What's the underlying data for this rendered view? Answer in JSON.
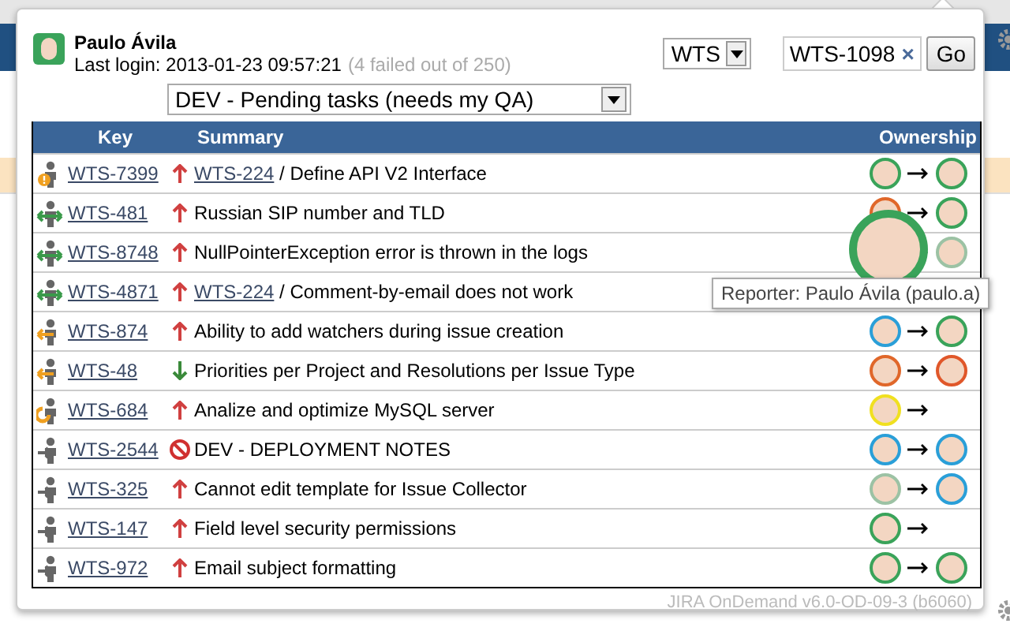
{
  "user": {
    "name": "Paulo Ávila",
    "last_login": "Last login: 2013-01-23 09:57:21",
    "failed": "(4 failed out of 250)"
  },
  "project_select": {
    "value": "WTS"
  },
  "issue_search": {
    "value": "WTS-1098",
    "clear": "×",
    "button": "Go"
  },
  "filter_select": {
    "value": "DEV - Pending tasks (needs my QA)"
  },
  "table": {
    "columns": [
      "Key",
      "Summary",
      "Ownership"
    ],
    "rows": [
      {
        "kind": "alert",
        "key": "WTS-7399",
        "priority": {
          "kind": "up"
        },
        "parent": "WTS-224",
        "summary": "/ Define API V2 Interface",
        "reporter": {
          "color": "#3aa35a"
        },
        "assignee": {
          "color": "#3aa35a"
        }
      },
      {
        "kind": "exchange",
        "key": "WTS-481",
        "priority": {
          "kind": "up"
        },
        "summary": "Russian SIP number and TLD",
        "reporter": {
          "color": "#e0672a"
        },
        "assignee": {
          "color": "#3aa35a"
        }
      },
      {
        "kind": "exchange",
        "key": "WTS-8748",
        "priority": {
          "kind": "up"
        },
        "summary": "NullPointerException error is thrown in the logs",
        "assignee": {
          "color": "#9cc2a4"
        }
      },
      {
        "kind": "exchange",
        "key": "WTS-4871",
        "priority": {
          "kind": "up"
        },
        "parent": "WTS-224",
        "summary": "/ Comment-by-email does not work"
      },
      {
        "kind": "return",
        "key": "WTS-874",
        "priority": {
          "kind": "up"
        },
        "summary": "Ability to add watchers during issue creation",
        "reporter": {
          "color": "#2a9fd8"
        },
        "assignee": {
          "color": "#3aa35a"
        }
      },
      {
        "kind": "return",
        "key": "WTS-48",
        "priority": {
          "kind": "down"
        },
        "summary": "Priorities per Project and Resolutions per Issue Type",
        "reporter": {
          "color": "#e0672a"
        },
        "assignee": {
          "color": "#e0572a"
        }
      },
      {
        "kind": "cycle",
        "key": "WTS-684",
        "priority": {
          "kind": "up"
        },
        "summary": "Analize and optimize MySQL server",
        "reporter": {
          "color": "#f0e020"
        }
      },
      {
        "kind": "incoming",
        "key": "WTS-2544",
        "priority": {
          "kind": "blocker"
        },
        "summary": "DEV - DEPLOYMENT NOTES",
        "reporter": {
          "color": "#2a9fd8"
        },
        "assignee": {
          "color": "#2a9fd8"
        }
      },
      {
        "kind": "incoming",
        "key": "WTS-325",
        "priority": {
          "kind": "up"
        },
        "summary": "Cannot edit template for Issue Collector",
        "reporter": {
          "color": "#9cc2a4"
        },
        "assignee": {
          "color": "#2a9fd8"
        }
      },
      {
        "kind": "incoming",
        "key": "WTS-147",
        "priority": {
          "kind": "up"
        },
        "summary": "Field level security permissions",
        "reporter": {
          "color": "#3aa35a"
        }
      },
      {
        "kind": "incoming",
        "key": "WTS-972",
        "priority": {
          "kind": "up"
        },
        "summary": "Email subject formatting",
        "reporter": {
          "color": "#3aa35a"
        },
        "assignee": {
          "color": "#3aa35a"
        }
      }
    ]
  },
  "hover_avatar": {
    "color": "#3aa35a",
    "tooltip": "Reporter: Paulo Ávila (paulo.a)"
  },
  "footer": "JIRA OnDemand v6.0-OD-09-3 (b6060)"
}
